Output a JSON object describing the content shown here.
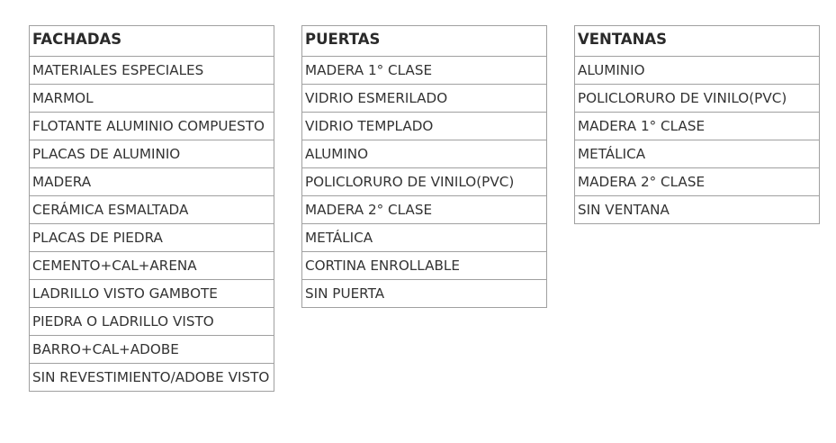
{
  "tables": [
    {
      "header": "FACHADAS",
      "rows": [
        "MATERIALES ESPECIALES",
        "MARMOL",
        "FLOTANTE ALUMINIO COMPUESTO",
        "PLACAS DE ALUMINIO",
        "MADERA",
        "CERÁMICA ESMALTADA",
        "PLACAS DE PIEDRA",
        "CEMENTO+CAL+ARENA",
        "LADRILLO VISTO GAMBOTE",
        "PIEDRA O LADRILLO VISTO",
        "BARRO+CAL+ADOBE",
        "SIN REVESTIMIENTO/ADOBE VISTO"
      ]
    },
    {
      "header": "PUERTAS",
      "rows": [
        "MADERA 1° CLASE",
        "VIDRIO ESMERILADO",
        "VIDRIO TEMPLADO",
        "ALUMINO",
        "POLICLORURO DE VINILO(PVC)",
        "MADERA 2° CLASE",
        "METÁLICA",
        "CORTINA ENROLLABLE",
        "SIN PUERTA"
      ]
    },
    {
      "header": "VENTANAS",
      "rows": [
        "ALUMINIO",
        "POLICLORURO DE VINILO(PVC)",
        "MADERA 1° CLASE",
        "METÁLICA",
        "MADERA 2° CLASE",
        "SIN VENTANA"
      ]
    }
  ]
}
